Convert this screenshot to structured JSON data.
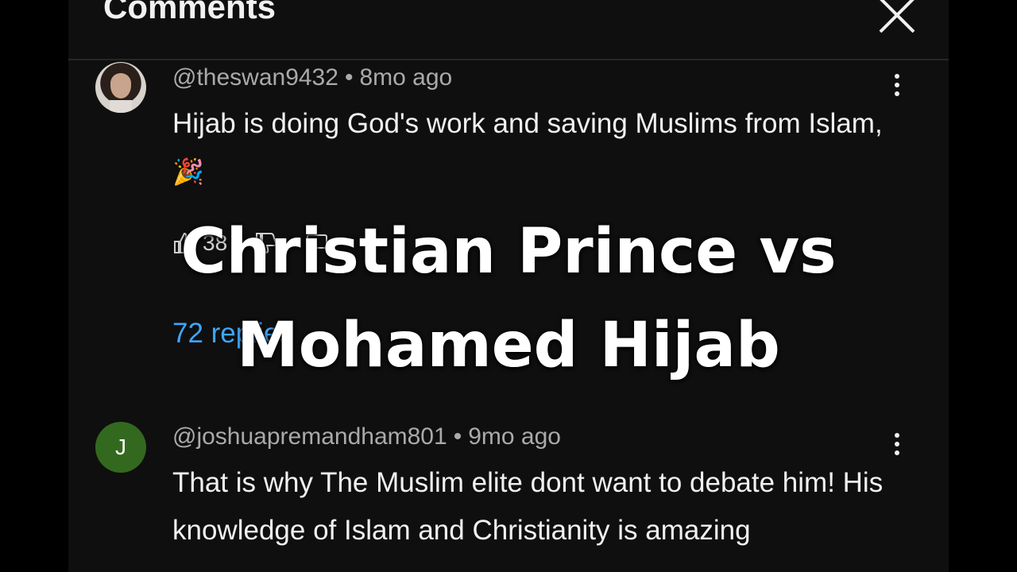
{
  "panel": {
    "title": "Comments",
    "close_icon": "close-icon"
  },
  "comments": [
    {
      "handle": "@theswan9432",
      "separator": "•",
      "time": "8mo ago",
      "text": "Hijab is doing God's work and saving Muslims from Islam,",
      "emoji": "🎉",
      "like_count": "38",
      "replies_label": "72 replies"
    },
    {
      "avatar_letter": "J",
      "avatar_color": "#33691e",
      "handle": "@joshuapremandham801",
      "separator": "•",
      "time": "9mo ago",
      "text": "That is why The Muslim elite dont want to debate him! His knowledge of Islam and Christianity is amazing"
    }
  ],
  "overlay": {
    "line1": "Christian Prince vs",
    "line2": "Mohamed Hijab"
  },
  "colors": {
    "background": "#0f0f0f",
    "text": "#f1f1f1",
    "meta": "#aaaaaa",
    "link": "#3ea6ff"
  }
}
